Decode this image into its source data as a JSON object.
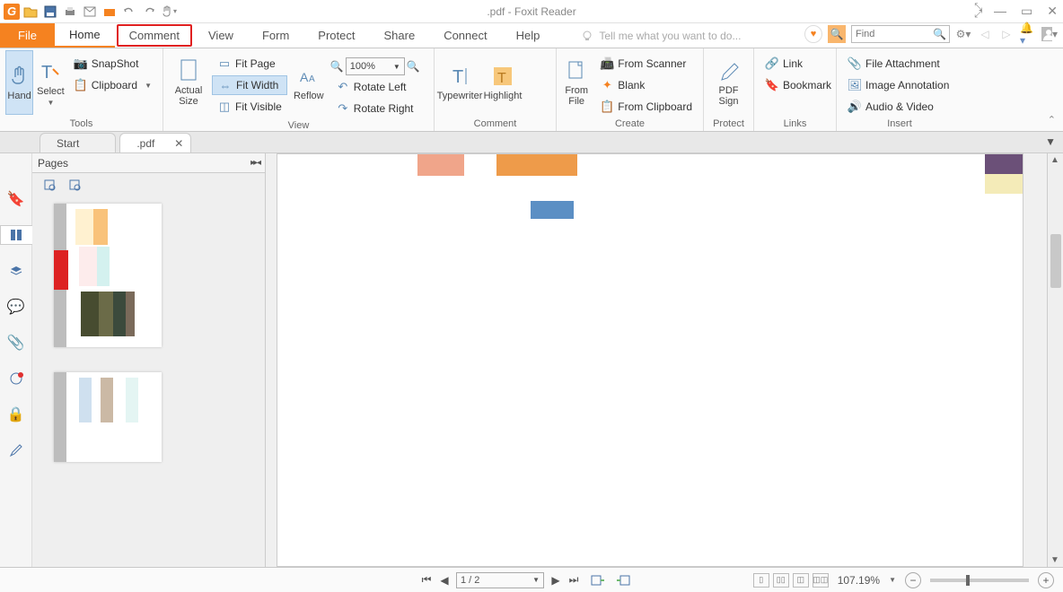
{
  "title": ".pdf - Foxit Reader",
  "qat_icons": [
    "open",
    "save",
    "print",
    "email",
    "snapshot",
    "undo",
    "redo",
    "hand-dd"
  ],
  "tabs": {
    "file": "File",
    "items": [
      "Home",
      "Comment",
      "View",
      "Form",
      "Protect",
      "Share",
      "Connect",
      "Help"
    ],
    "active": "Home",
    "highlighted": "Comment",
    "tellme": "Tell me what you want to do..."
  },
  "find_placeholder": "Find",
  "ribbon": {
    "tools": {
      "label": "Tools",
      "hand": "Hand",
      "select": "Select",
      "snapshot": "SnapShot",
      "clipboard": "Clipboard"
    },
    "view": {
      "label": "View",
      "actual": "Actual Size",
      "fit_page": "Fit Page",
      "fit_width": "Fit Width",
      "fit_visible": "Fit Visible",
      "reflow": "Reflow",
      "zoom_out": "−",
      "zoom_val": "100%",
      "zoom_in": "+",
      "rotate_left": "Rotate Left",
      "rotate_right": "Rotate Right"
    },
    "comment": {
      "label": "Comment",
      "typewriter": "Typewriter",
      "highlight": "Highlight"
    },
    "create": {
      "label": "Create",
      "from_file": "From File",
      "from_scanner": "From Scanner",
      "blank": "Blank",
      "from_clipboard": "From Clipboard"
    },
    "protect": {
      "label": "Protect",
      "pdf_sign": "PDF Sign"
    },
    "links": {
      "label": "Links",
      "link": "Link",
      "bookmark": "Bookmark"
    },
    "insert": {
      "label": "Insert",
      "file_attachment": "File Attachment",
      "image_annotation": "Image Annotation",
      "audio_video": "Audio & Video"
    }
  },
  "doctabs": {
    "start": "Start",
    "pdf": ".pdf"
  },
  "pages_panel": {
    "title": "Pages"
  },
  "statusbar": {
    "page": "1 / 2",
    "zoom": "107.19%"
  }
}
